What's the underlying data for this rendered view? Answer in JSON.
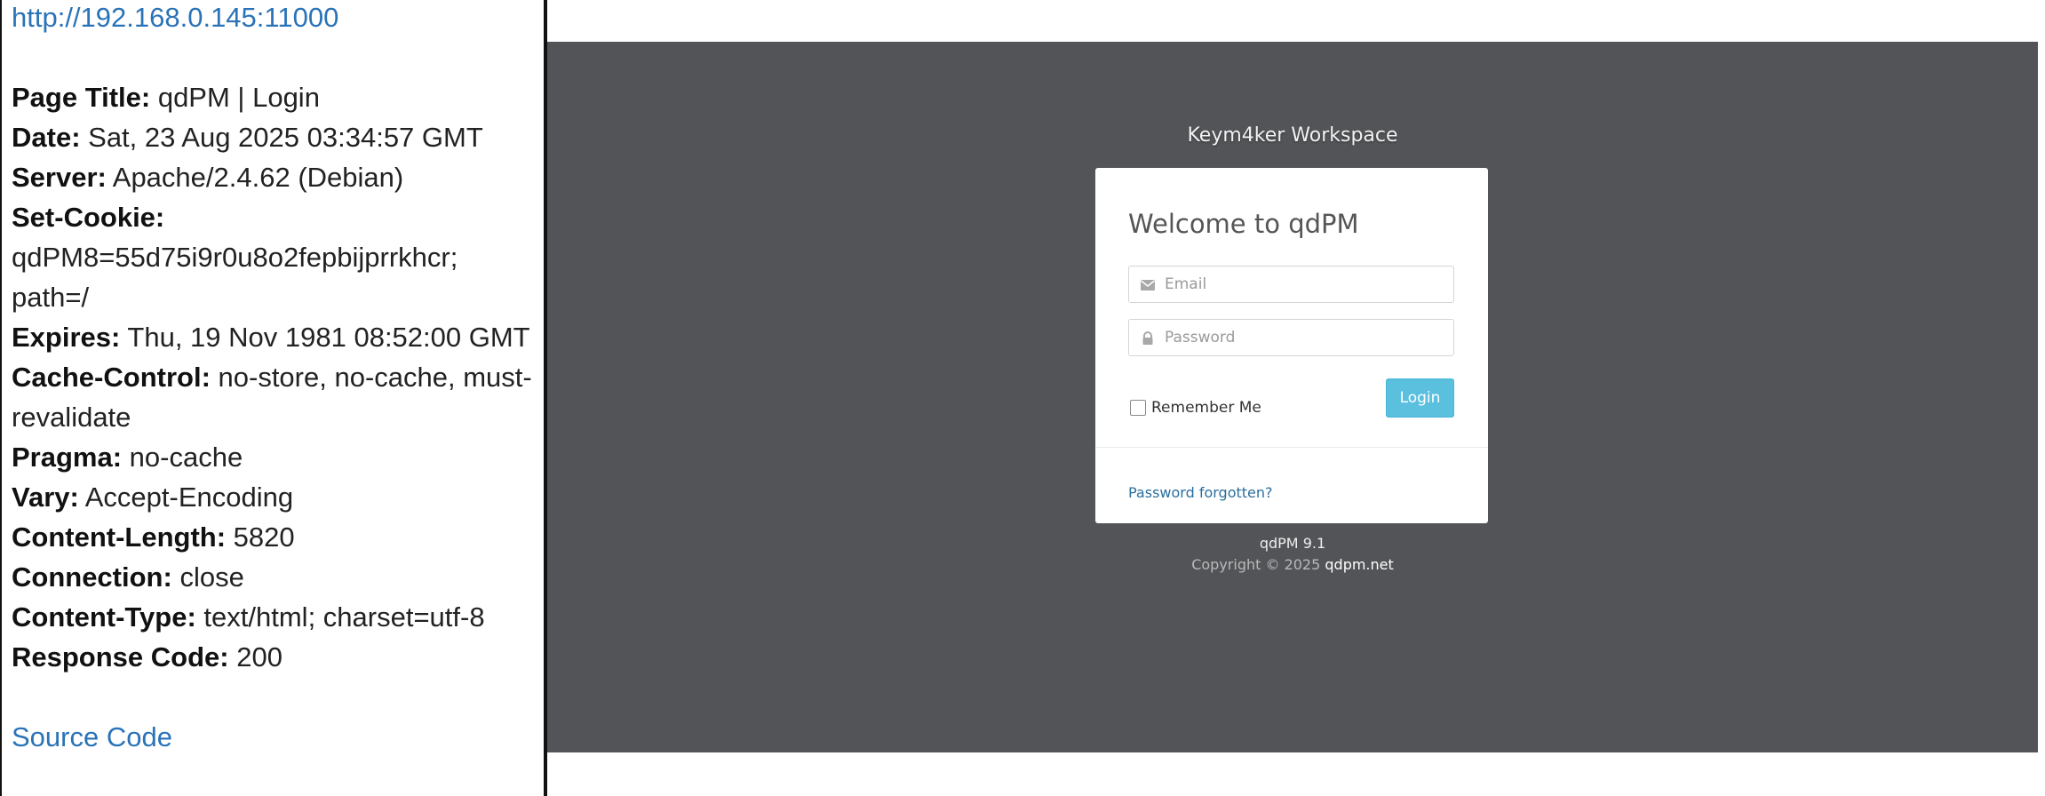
{
  "left_panel": {
    "url": "http://192.168.0.145:11000",
    "headers": [
      {
        "key": "Page Title:",
        "value": "qdPM | Login"
      },
      {
        "key": "Date:",
        "value": "Sat, 23 Aug 2025 03:34:57 GMT"
      },
      {
        "key": "Server:",
        "value": "Apache/2.4.62 (Debian)"
      },
      {
        "key": "Set-Cookie:",
        "value": "qdPM8=55d75i9r0u8o2fepbijprrkhcr; path=/"
      },
      {
        "key": "Expires:",
        "value": "Thu, 19 Nov 1981 08:52:00 GMT"
      },
      {
        "key": "Cache-Control:",
        "value": "no-store, no-cache, must-revalidate"
      },
      {
        "key": "Pragma:",
        "value": "no-cache"
      },
      {
        "key": "Vary:",
        "value": "Accept-Encoding"
      },
      {
        "key": "Content-Length:",
        "value": "5820"
      },
      {
        "key": "Connection:",
        "value": "close"
      },
      {
        "key": "Content-Type:",
        "value": "text/html; charset=utf-8"
      },
      {
        "key": "Response Code:",
        "value": "200"
      }
    ],
    "source_code_label": "Source Code"
  },
  "app": {
    "workspace_title": "Keym4ker Workspace",
    "login": {
      "title": "Welcome to qdPM",
      "email_placeholder": "Email",
      "email_value": "",
      "password_placeholder": "Password",
      "password_value": "",
      "remember_label": "Remember Me",
      "remember_checked": false,
      "login_button": "Login",
      "forgot_link": "Password forgotten?"
    },
    "footer": {
      "version": "qdPM 9.1",
      "copyright_prefix": "Copyright © 2025 ",
      "brand_link": "qdpm.net"
    },
    "icons": {
      "email_icon": "envelope-icon",
      "password_icon": "lock-icon"
    },
    "colors": {
      "background": "#535458",
      "button": "#5bc0de",
      "link": "#2a73b8"
    }
  }
}
